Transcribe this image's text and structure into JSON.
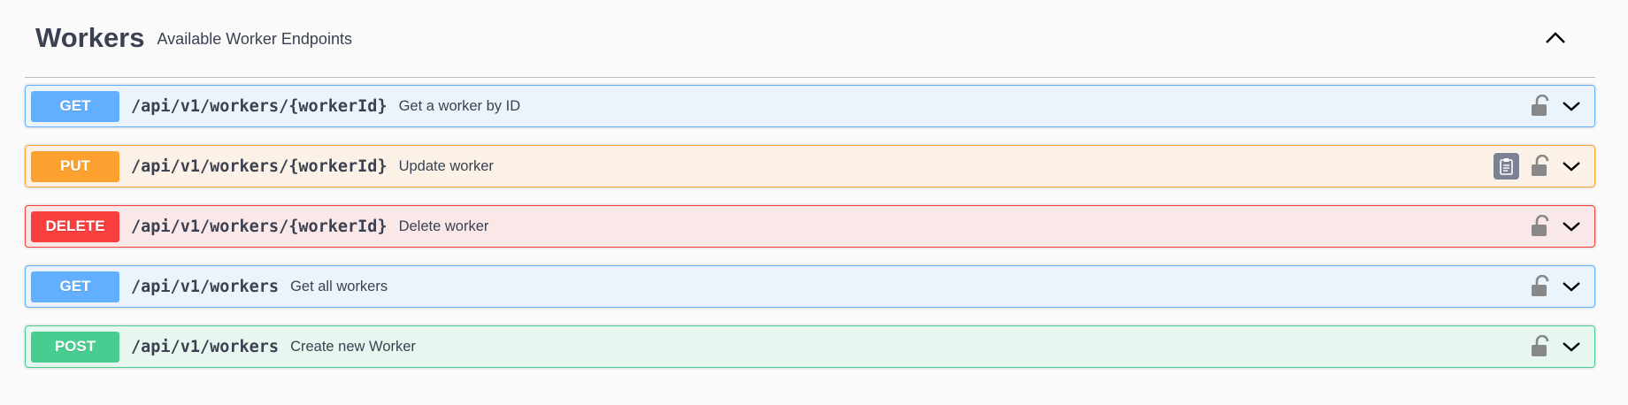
{
  "tag": {
    "title": "Workers",
    "description": "Available Worker Endpoints"
  },
  "colors": {
    "get": "#61affe",
    "put": "#fca130",
    "delete": "#f93e3e",
    "post": "#49cc90",
    "text": "#3b4151"
  },
  "operations": [
    {
      "method": "GET",
      "path": "/api/v1/workers/{workerId}",
      "summary": "Get a worker by ID",
      "icons": [
        "lock-icon",
        "chevron-down-icon"
      ]
    },
    {
      "method": "PUT",
      "path": "/api/v1/workers/{workerId}",
      "summary": "Update worker",
      "icons": [
        "copy-clipboard-icon",
        "lock-icon",
        "chevron-down-icon"
      ]
    },
    {
      "method": "DELETE",
      "path": "/api/v1/workers/{workerId}",
      "summary": "Delete worker",
      "icons": [
        "lock-icon",
        "chevron-down-icon"
      ]
    },
    {
      "method": "GET",
      "path": "/api/v1/workers",
      "summary": "Get all workers",
      "icons": [
        "lock-icon",
        "chevron-down-icon"
      ]
    },
    {
      "method": "POST",
      "path": "/api/v1/workers",
      "summary": "Create new Worker",
      "icons": [
        "lock-icon",
        "chevron-down-icon"
      ]
    }
  ]
}
